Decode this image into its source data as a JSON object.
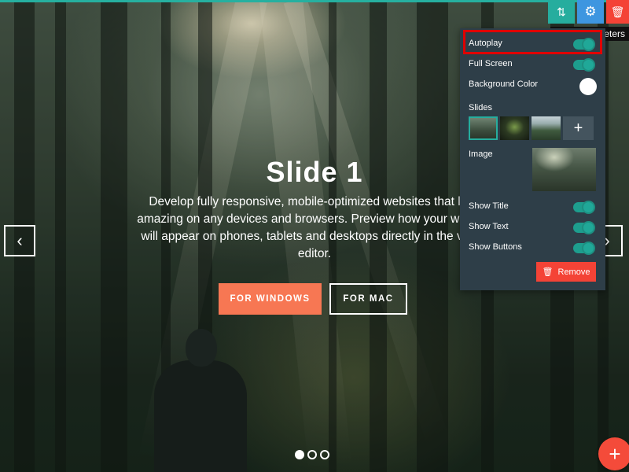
{
  "slide": {
    "title": "Slide 1",
    "text": "Develop fully responsive, mobile-optimized websites that look amazing on any devices and browsers. Preview how your website will appear on phones, tablets and desktops directly in the visual editor.",
    "buttons": {
      "windows": "FOR WINDOWS",
      "mac": "FOR MAC"
    },
    "prev_icon": "chevron-left-icon",
    "next_icon": "chevron-right-icon",
    "prev_glyph": "‹",
    "next_glyph": "›",
    "dots": {
      "count": 3,
      "active_index": 0
    }
  },
  "toolbar": {
    "move_glyph": "⇅",
    "gear_glyph": "⚙",
    "delete_glyph": "🗑",
    "tooltip": "Parameters"
  },
  "panel": {
    "autoplay": {
      "label": "Autoplay",
      "on": true
    },
    "full_screen": {
      "label": "Full Screen",
      "on": true
    },
    "background_color": {
      "label": "Background Color",
      "value": "#ffffff"
    },
    "slides_label": "Slides",
    "add_slide_glyph": "+",
    "image_label": "Image",
    "show_title": {
      "label": "Show Title",
      "on": true
    },
    "show_text": {
      "label": "Show Text",
      "on": true
    },
    "show_buttons": {
      "label": "Show Buttons",
      "on": true
    },
    "remove_label": "Remove",
    "remove_glyph": "🗑"
  },
  "fab_glyph": "+",
  "colors": {
    "accent_teal": "#26ad9e",
    "gear_blue": "#3e96e0",
    "danger_red": "#f44336",
    "button_orange": "#f77753",
    "panel_bg": "#2e3e48"
  }
}
